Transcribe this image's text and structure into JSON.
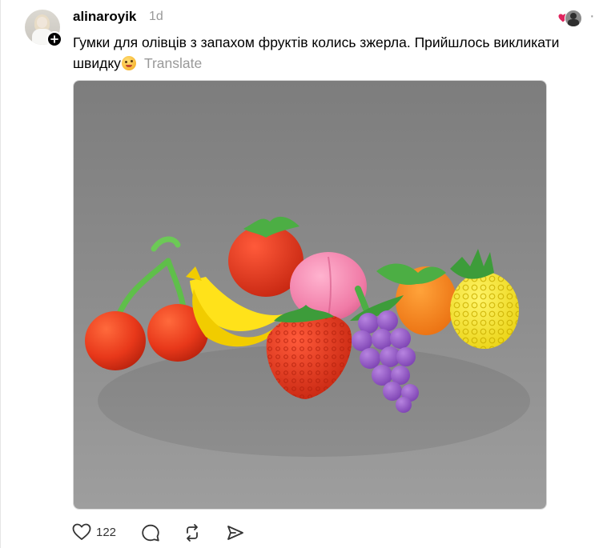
{
  "post": {
    "author": "alinaroyik",
    "time": "1d",
    "text": "Гумки для олівців з запахом фруктів колись зжерла. Прийшлось викликати швидку",
    "emoji": "nerd-face-emoji",
    "translate_label": "Translate",
    "image_alt": "Fruit-shaped scented pencil erasers: cherries, banana, tomato, peach, strawberry, grapes, mandarin, pineapple",
    "like_count": "122"
  },
  "colors": {
    "heart": "#e0245e",
    "secondary_text": "#999999",
    "photo_background": "#8e8e8e"
  },
  "icons": {
    "like": "heart-icon",
    "comment": "comment-bubble-icon",
    "repost": "repost-icon",
    "share": "send-icon",
    "follow": "plus-icon",
    "liked_by": "heart-icon"
  }
}
